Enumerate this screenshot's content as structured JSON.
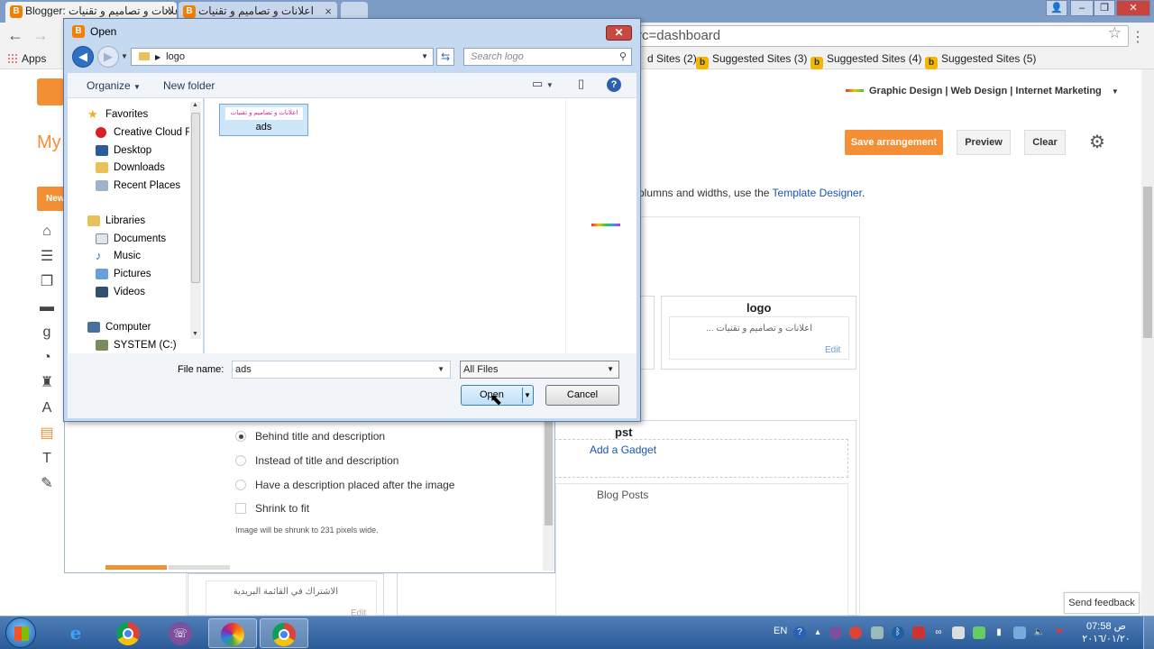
{
  "browser": {
    "tabs": [
      {
        "title": "Blogger: اعلانات و تصاميم و تقنيات"
      },
      {
        "title": "اعلانات و تصاميم و تقنيات"
      }
    ],
    "address": "rc=dashboard",
    "bookmarks": {
      "apps": "Apps",
      "items": [
        "d Sites (2)",
        "Suggested Sites (3)",
        "Suggested Sites (4)",
        "Suggested Sites (5)"
      ]
    }
  },
  "blogger": {
    "my_label": "My",
    "new_label": "New",
    "blog_selector": "Graphic Design | Web Design | Internet Marketing",
    "save_label": "Save arrangement",
    "preview_label": "Preview",
    "clear_label": "Clear",
    "designer_hint_prefix": "olumns and widths, use the ",
    "designer_link": "Template Designer",
    "designer_hint_suffix": ".",
    "logo_gadget": {
      "title": "logo",
      "content": "اعلانات و تصاميم و تقنيات ...",
      "edit": "Edit"
    },
    "pst_gadget": {
      "title": "pst",
      "add": "Add a Gadget"
    },
    "blog_posts": "Blog Posts",
    "subscribe_gadget": {
      "content": "الاشتراك في القائمة البريدية",
      "edit": "Edit"
    },
    "send_feedback": "Send feedback"
  },
  "config_dialog": {
    "options": [
      {
        "label": "Behind title and description",
        "selected": true
      },
      {
        "label": "Instead of title and description",
        "selected": false
      },
      {
        "label": "Have a description placed after the image",
        "selected": false
      }
    ],
    "shrink_label": "Shrink to fit",
    "shrink_note": "Image will be shrunk to 231 pixels wide."
  },
  "open_dialog": {
    "title": "Open",
    "path": "logo",
    "search_placeholder": "Search logo",
    "organize": "Organize",
    "new_folder": "New folder",
    "nav": {
      "favorites": "Favorites",
      "favorites_items": [
        "Creative Cloud Fi",
        "Desktop",
        "Downloads",
        "Recent Places"
      ],
      "libraries": "Libraries",
      "libraries_items": [
        "Documents",
        "Music",
        "Pictures",
        "Videos"
      ],
      "computer": "Computer",
      "computer_items": [
        "SYSTEM (C:)"
      ]
    },
    "file": {
      "name": "ads",
      "thumb_text": "اعلانات و تصاميم و تقنيات"
    },
    "filename_label": "File name:",
    "filename_value": "ads",
    "filetype_value": "All Files",
    "open_label": "Open",
    "cancel_label": "Cancel"
  },
  "taskbar": {
    "language": "EN",
    "clock_time": "07:58 ص",
    "clock_date": "٢٠١٦/٠١/٢٠"
  },
  "colors": {
    "blogger_orange": "#f58f35",
    "link_blue": "#1a56b0",
    "taskbar_blue": "#2b5b96"
  }
}
